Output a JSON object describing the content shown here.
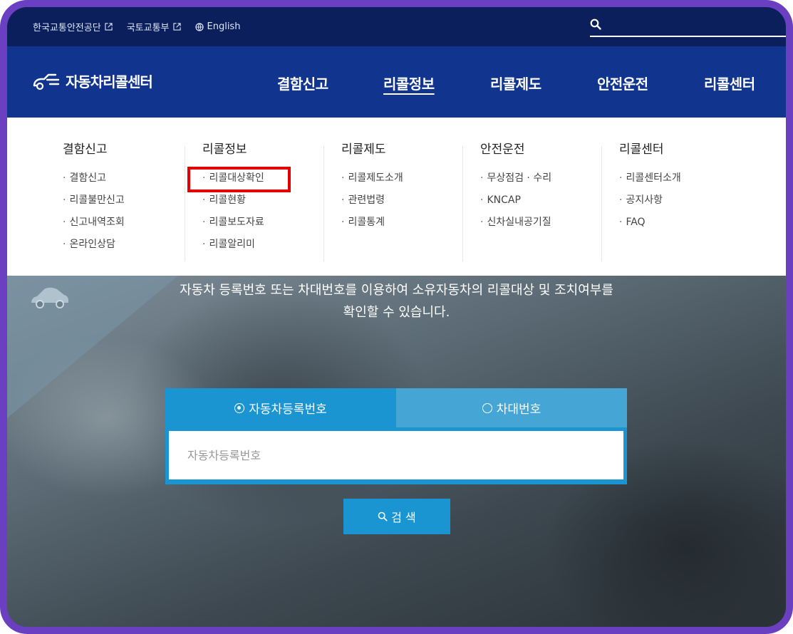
{
  "util": {
    "links": [
      {
        "label": "한국교통안전공단",
        "icon": "external-link-icon"
      },
      {
        "label": "국토교통부",
        "icon": "external-link-icon"
      },
      {
        "label": "English",
        "icon": "globe-icon"
      }
    ],
    "search_placeholder": ""
  },
  "brand": {
    "name": "자동차리콜센터",
    "icon": "car-logo-icon"
  },
  "nav": {
    "items": [
      "결함신고",
      "리콜정보",
      "리콜제도",
      "안전운전",
      "리콜센터"
    ],
    "active": "리콜정보"
  },
  "mega": [
    {
      "title": "결함신고",
      "items": [
        "결함신고",
        "리콜불만신고",
        "신고내역조회",
        "온라인상담"
      ]
    },
    {
      "title": "리콜정보",
      "items": [
        "리콜대상확인",
        "리콜현황",
        "리콜보도자료",
        "리콜알리미"
      ]
    },
    {
      "title": "리콜제도",
      "items": [
        "리콜제도소개",
        "관련법령",
        "리콜통계"
      ]
    },
    {
      "title": "안전운전",
      "items": [
        "무상점검 · 수리",
        "KNCAP",
        "신차실내공기질"
      ]
    },
    {
      "title": "리콜센터",
      "items": [
        "리콜센터소개",
        "공지사항",
        "FAQ"
      ]
    }
  ],
  "hero": {
    "line1": "자동차 등록번호 또는 차대번호를 이용하여 소유자동차의 리콜대상 및 조치여부를",
    "line2": "확인할 수 있습니다."
  },
  "search": {
    "tab_reg": "자동차등록번호",
    "tab_vin": "차대번호",
    "selected": "자동차등록번호",
    "placeholder": "자동차등록번호",
    "button": "검 색"
  },
  "colors": {
    "util_bg": "#0b1f5c",
    "nav_bg": "#11348e",
    "accent": "#1a95d2",
    "highlight": "#e30000"
  }
}
